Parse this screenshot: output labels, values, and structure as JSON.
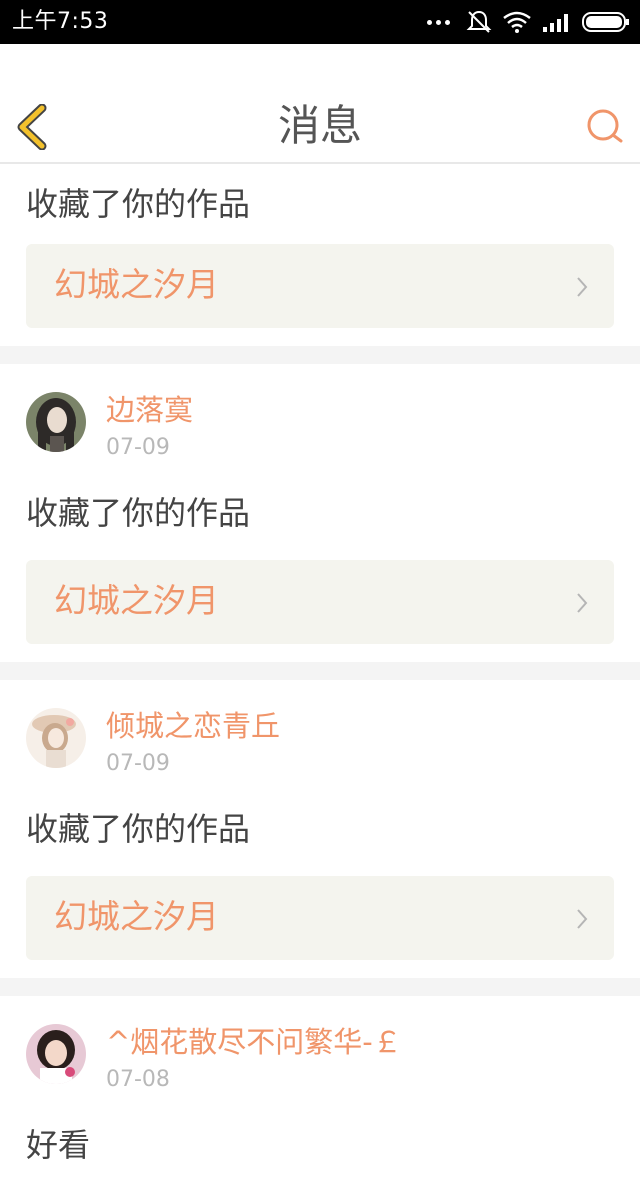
{
  "status_bar": {
    "time": "上午7:53"
  },
  "nav": {
    "title": "消息",
    "back_icon": "chevron-left-icon",
    "search_icon": "search-icon"
  },
  "colors": {
    "accent": "#f0956a",
    "work_bg": "#f4f4ee",
    "back_icon": "#f3c12c"
  },
  "messages": [
    {
      "action": "收藏了你的作品",
      "work_title": "幻城之汐月"
    },
    {
      "user": "边落寞",
      "date": "07-09",
      "action": "收藏了你的作品",
      "work_title": "幻城之汐月"
    },
    {
      "user": "倾城之恋青丘",
      "date": "07-09",
      "action": "收藏了你的作品",
      "work_title": "幻城之汐月"
    },
    {
      "user": "^烟花散尽不问繁华-￡",
      "date": "07-08",
      "action": "好看"
    }
  ]
}
